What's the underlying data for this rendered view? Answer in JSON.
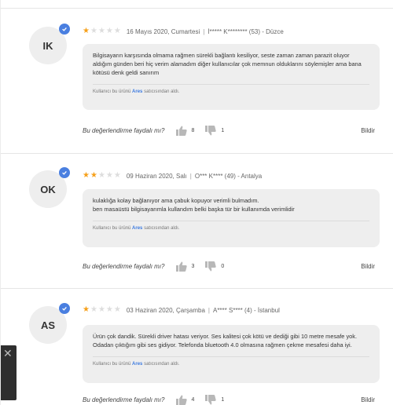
{
  "reviews": [
    {
      "initials": "IK",
      "rating": 1,
      "date": "16 Mayıs 2020, Cumartesi",
      "author": "İ***** K******** (53) - Düzce",
      "text": "Bilgisayarın karşısında olmama rağmen sürekli bağlantı kesiliyor, seste zaman zaman parazit oluyor aldığım günden beri hiç verim alamadım diğer kullanıcılar çok memnun olduklarını söylemişler ama bana kötüsü denk geldi sanırım",
      "seller_prefix": "Kullanıcı bu ürünü",
      "seller": "Ares",
      "seller_suffix": "satıcısından aldı.",
      "helpful_question": "Bu değerlendirme faydalı mı?",
      "likes": "8",
      "dislikes": "1",
      "report": "Bildir"
    },
    {
      "initials": "OK",
      "rating": 2,
      "date": "09 Haziran 2020, Salı",
      "author": "O*** K**** (49) - Antalya",
      "text": "kulaklığa kolay bağlanıyor ama çabuk kopuyor verimli bulmadım.\nben masaüstü bilgisayarımla kullandım belki başka tür bir kullanımda verimlidir",
      "seller_prefix": "Kullanıcı bu ürünü",
      "seller": "Ares",
      "seller_suffix": "satıcısından aldı.",
      "helpful_question": "Bu değerlendirme faydalı mı?",
      "likes": "3",
      "dislikes": "0",
      "report": "Bildir"
    },
    {
      "initials": "AS",
      "rating": 1,
      "date": "03 Haziran 2020, Çarşamba",
      "author": "A**** S**** (4) - İstanbul",
      "text": "Ürün çok dandik. Sürekli driver hatası veriyor. Ses kalitesi çok kötü ve dediği gibi 10 metre mesafe yok. Odadan çıktığım gibi ses gidiyor. Telefonda bluetooth 4.0 olmasına rağmen çekme mesafesi daha iyi.",
      "seller_prefix": "Kullanıcı bu ürünü",
      "seller": "Ares",
      "seller_suffix": "satıcısından aldı.",
      "helpful_question": "Bu değerlendirme faydalı mı?",
      "likes": "4",
      "dislikes": "1",
      "report": "Bildir"
    }
  ],
  "side_panel": {
    "close_glyph": "✕"
  },
  "colors": {
    "star_on": "#f6a01a",
    "star_off": "#dddddd",
    "verified": "#4a7fe0",
    "seller_link": "#3d7be0",
    "bubble_bg": "#eeeeee"
  },
  "icons": {
    "verified": "check-badge-icon",
    "like": "thumbs-up-icon",
    "dislike": "thumbs-down-icon",
    "close": "close-icon"
  }
}
